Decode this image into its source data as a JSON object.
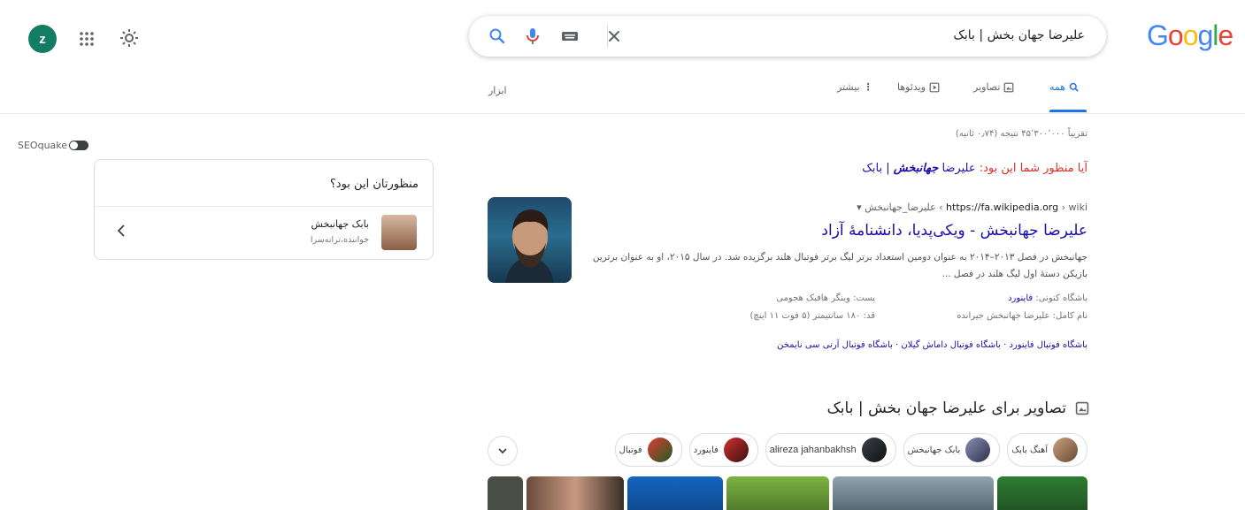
{
  "profile": {
    "initial": "z",
    "color": "#137d63"
  },
  "search": {
    "query": "علیرضا جهان بخش | بابک"
  },
  "logo": {
    "letters": [
      "G",
      "o",
      "o",
      "g",
      "l",
      "e"
    ],
    "colors": [
      "#4285f4",
      "#ea4335",
      "#fbbc05",
      "#4285f4",
      "#34a853",
      "#ea4335"
    ]
  },
  "tabs": {
    "all": "همه",
    "images": "تصاویر",
    "videos": "ویدئوها",
    "more": "بیشتر",
    "tools": "ابزار"
  },
  "results": {
    "stats": "تقریباً ۴۵٬۳۰۰٬۰۰۰ نتیجه (۰٫۷۴ ثانیه)",
    "did_you_mean_label": "آیا منظور شما این بود:",
    "did_you_mean_plain": "علیرضا",
    "did_you_mean_bold": "جهانبخش",
    "did_you_mean_suffix": "| بابک",
    "wiki": {
      "url": "https://fa.wikipedia.org",
      "path": "› wiki › علیرضا_جهانبخش",
      "title": "علیرضا جهانبخش - ویکی‌پدیا، دانشنامهٔ آزاد",
      "snippet": "جهانبخش در فصل ۲۰۱۳–۲۰۱۴ به عنوان دومین استعداد برتر لیگ برتر فوتبال هلند برگزیده شد. در سال ۲۰۱۵، او به عنوان برترین بازیکن دستهٔ اول لیگ هلند در فصل ...",
      "club_label": "باشگاه کنونی:",
      "club_value": "فاینورد",
      "position": "پست: وینگر هافبک هجومی",
      "fullname": "نام کامل: علیرضا جهانبخش جیرانده",
      "height": "قد: ۱۸۰ سانتیمتر (۵ فوت ۱۱ اینچ)",
      "related": "باشگاه فوتبال فاینورد · باشگاه فوتبال داماش گیلان · باشگاه فوتبال آرنی سی نایمخن"
    },
    "images_header": "تصاویر برای علیرضا جهان بخش | بابک",
    "chips": [
      "آهنگ بابک",
      "بابک جهانبخش",
      "alireza jahanbakhsh",
      "فاینورد",
      "فوتبال"
    ]
  },
  "seoquake": {
    "label": "SEOquake"
  },
  "side_box": {
    "title": "منظورتان این بود؟",
    "person_name": "بابک جهانبخش",
    "person_desc": "خواننده،ترانه‌سرا"
  }
}
